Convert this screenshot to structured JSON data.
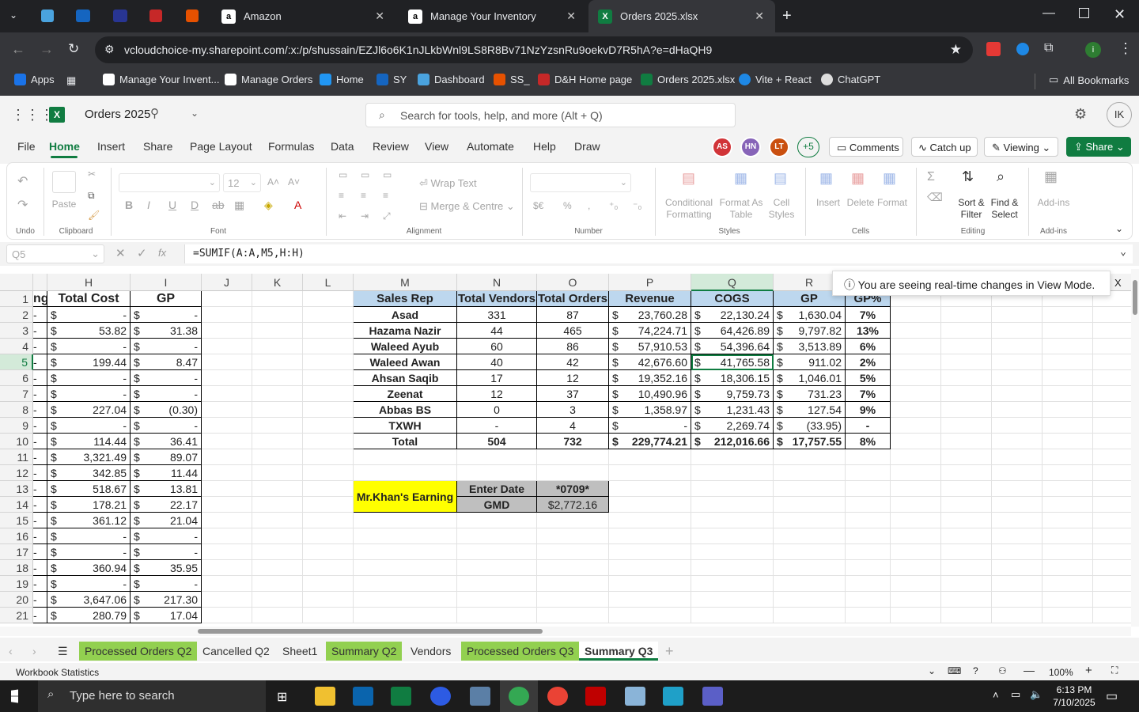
{
  "browser": {
    "tabs": [
      {
        "label": "Amazon",
        "active": false
      },
      {
        "label": "Manage Your Inventory",
        "active": false
      },
      {
        "label": "Orders 2025.xlsx",
        "active": true
      }
    ],
    "url": "vcloudchoice-my.sharepoint.com/:x:/p/shussain/EZJl6o6K1nJLkbWnl9LS8R8Bv71NzYzsnRu9oekvD7R5hA?e=dHaQH9",
    "bookmarks": [
      "Apps",
      "Manage Your Invent...",
      "Manage Orders",
      "Home",
      "SY",
      "Dashboard",
      "SS_",
      "D&H Home page",
      "Orders 2025.xlsx",
      "Vite + React",
      "ChatGPT"
    ],
    "all_bookmarks": "All Bookmarks"
  },
  "excel": {
    "file_title": "Orders 2025",
    "search_placeholder": "Search for tools, help, and more (Alt + Q)",
    "user_initials": "IK",
    "menu": [
      "File",
      "Home",
      "Insert",
      "Share",
      "Page Layout",
      "Formulas",
      "Data",
      "Review",
      "View",
      "Automate",
      "Help",
      "Draw"
    ],
    "collaborators": [
      "AS",
      "HN",
      "LT"
    ],
    "more_collaborators": "+5",
    "comments": "Comments",
    "catch_up": "Catch up",
    "viewing": "Viewing",
    "share": "Share",
    "ribbon": {
      "undo": "Undo",
      "paste": "Paste",
      "clipboard": "Clipboard",
      "font_size": "12",
      "font": "Font",
      "wrap_text": "Wrap Text",
      "merge": "Merge & Centre",
      "alignment": "Alignment",
      "number": "Number",
      "conditional": "Conditional Formatting",
      "format_table": "Format As Table",
      "cell_styles": "Cell Styles",
      "styles": "Styles",
      "insert": "Insert",
      "delete": "Delete",
      "format": "Format",
      "cells": "Cells",
      "sort": "Sort & Filter",
      "find": "Find & Select",
      "editing": "Editing",
      "addins": "Add-ins"
    },
    "name_box": "Q5",
    "formula": "=SUMIF(A:A,M5,H:H)",
    "view_mode_msg": "You are seeing real-time changes in View Mode.",
    "columns": [
      "H",
      "I",
      "J",
      "K",
      "L",
      "M",
      "N",
      "O",
      "P",
      "Q",
      "R"
    ],
    "rows": [
      "1",
      "2",
      "3",
      "4",
      "5",
      "6",
      "7",
      "8",
      "9",
      "10",
      "11",
      "12",
      "13",
      "14",
      "15",
      "16",
      "17",
      "18",
      "19",
      "20",
      "21"
    ],
    "left_table": {
      "stub": "ng",
      "headers": [
        "Total Cost",
        "GP"
      ],
      "rows": [
        [
          "-",
          "-"
        ],
        [
          "53.82",
          "31.38"
        ],
        [
          "-",
          "-"
        ],
        [
          "199.44",
          "8.47"
        ],
        [
          "-",
          "-"
        ],
        [
          "-",
          "-"
        ],
        [
          "227.04",
          "(0.30)"
        ],
        [
          "-",
          "-"
        ],
        [
          "114.44",
          "36.41"
        ],
        [
          "3,321.49",
          "89.07"
        ],
        [
          "342.85",
          "11.44"
        ],
        [
          "518.67",
          "13.81"
        ],
        [
          "178.21",
          "22.17"
        ],
        [
          "361.12",
          "21.04"
        ],
        [
          "-",
          "-"
        ],
        [
          "-",
          "-"
        ],
        [
          "360.94",
          "35.95"
        ],
        [
          "-",
          "-"
        ],
        [
          "3,647.06",
          "217.30"
        ],
        [
          "280.79",
          "17.04"
        ]
      ]
    },
    "summary": {
      "headers": [
        "Sales Rep",
        "Total Vendors",
        "Total Orders",
        "Revenue",
        "COGS",
        "GP",
        "GP%"
      ],
      "rows": [
        [
          "Asad",
          "331",
          "87",
          "23,760.28",
          "22,130.24",
          "1,630.04",
          "7%"
        ],
        [
          "Hazama Nazir",
          "44",
          "465",
          "74,224.71",
          "64,426.89",
          "9,797.82",
          "13%"
        ],
        [
          "Waleed Ayub",
          "60",
          "86",
          "57,910.53",
          "54,396.64",
          "3,513.89",
          "6%"
        ],
        [
          "Waleed Awan",
          "40",
          "42",
          "42,676.60",
          "41,765.58",
          "911.02",
          "2%"
        ],
        [
          "Ahsan Saqib",
          "17",
          "12",
          "19,352.16",
          "18,306.15",
          "1,046.01",
          "5%"
        ],
        [
          "Zeenat",
          "12",
          "37",
          "10,490.96",
          "9,759.73",
          "731.23",
          "7%"
        ],
        [
          "Abbas BS",
          "0",
          "3",
          "1,358.97",
          "1,231.43",
          "127.54",
          "9%"
        ],
        [
          "TXWH",
          "-",
          "4",
          "-",
          "2,269.74",
          "(33.95)",
          "-"
        ],
        [
          "Total",
          "504",
          "732",
          "229,774.21",
          "212,016.66",
          "17,757.55",
          "8%"
        ]
      ]
    },
    "earning": {
      "label": "Mr.Khan's Earning",
      "enter_date": "Enter Date",
      "date_value": "*0709*",
      "gmd": "GMD",
      "gmd_value": "$2,772.16"
    },
    "sheet_tabs": [
      "Processed Orders Q2",
      "Cancelled Q2",
      "Sheet1",
      "Summary Q2",
      "Vendors",
      "Processed Orders Q3",
      "Summary Q3"
    ],
    "workbook_stats": "Workbook Statistics",
    "zoom": "100%"
  },
  "taskbar": {
    "search": "Type here to search",
    "time": "6:13 PM",
    "date": "7/10/2025"
  }
}
